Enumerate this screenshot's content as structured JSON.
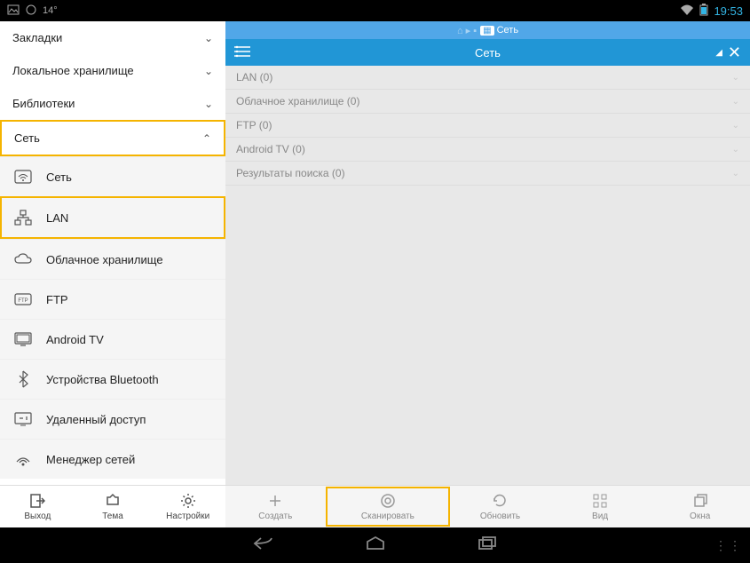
{
  "status": {
    "temp": "14°",
    "time": "19:53"
  },
  "breadcrumb": {
    "label": "Сеть"
  },
  "titlebar": {
    "title": "Сеть"
  },
  "sidebar": {
    "sections": [
      {
        "label": "Закладки",
        "expanded": false
      },
      {
        "label": "Локальное хранилище",
        "expanded": false
      },
      {
        "label": "Библиотеки",
        "expanded": false
      },
      {
        "label": "Сеть",
        "expanded": true
      }
    ],
    "net_items": [
      {
        "label": "Сеть",
        "icon": "wifi-box"
      },
      {
        "label": "LAN",
        "icon": "lan"
      },
      {
        "label": "Облачное хранилище",
        "icon": "cloud"
      },
      {
        "label": "FTP",
        "icon": "ftp"
      },
      {
        "label": "Android TV",
        "icon": "tv"
      },
      {
        "label": "Устройства Bluetooth",
        "icon": "bluetooth"
      },
      {
        "label": "Удаленный доступ",
        "icon": "remote"
      },
      {
        "label": "Менеджер сетей",
        "icon": "net-mgr"
      }
    ],
    "bottom": [
      {
        "label": "Выход"
      },
      {
        "label": "Тема"
      },
      {
        "label": "Настройки"
      }
    ]
  },
  "main": {
    "categories": [
      {
        "label": "LAN (0)"
      },
      {
        "label": "Облачное хранилище (0)"
      },
      {
        "label": "FTP (0)"
      },
      {
        "label": "Android TV (0)"
      },
      {
        "label": "Результаты поиска (0)"
      }
    ],
    "toolbar": [
      {
        "label": "Создать"
      },
      {
        "label": "Сканировать"
      },
      {
        "label": "Обновить"
      },
      {
        "label": "Вид"
      },
      {
        "label": "Окна"
      }
    ]
  }
}
